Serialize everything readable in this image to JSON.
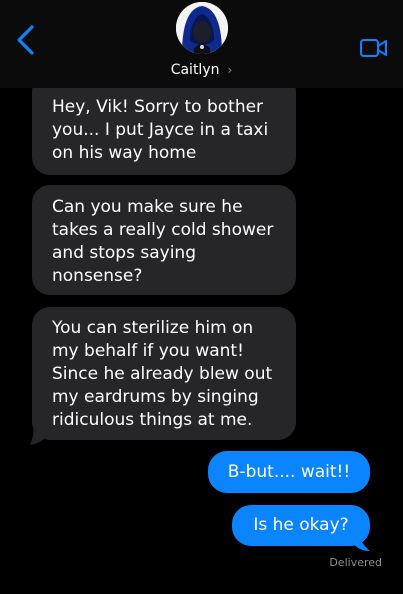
{
  "header": {
    "contact_name": "Caitlyn",
    "chevron": "›",
    "back_icon": "chevron-left-icon",
    "video_icon": "video-camera-icon",
    "accent_color": "#0a84ff"
  },
  "messages": [
    {
      "direction": "incoming",
      "text": "Hey, Vik! Sorry to bother you... I put Jayce in a taxi on his way home"
    },
    {
      "direction": "incoming",
      "text": "Can you make sure he takes a really cold shower and stops saying nonsense?"
    },
    {
      "direction": "incoming",
      "text": "You can sterilize him on my behalf if you want! Since he already blew out my eardrums by singing ridiculous things at me."
    },
    {
      "direction": "outgoing",
      "text": "B-but.... wait!!"
    },
    {
      "direction": "outgoing",
      "text": "Is he okay?"
    }
  ],
  "status": {
    "delivered": "Delivered"
  },
  "colors": {
    "incoming_bubble": "#262628",
    "outgoing_bubble": "#0a84ff",
    "background": "#000000"
  }
}
